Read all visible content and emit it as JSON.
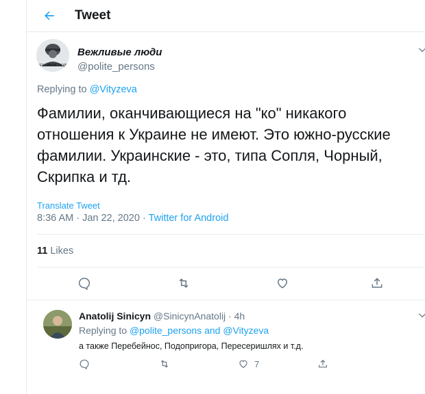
{
  "colors": {
    "accent": "#1da1f2",
    "secondary_text": "#657786",
    "divider": "#e6ecf0"
  },
  "header": {
    "title": "Tweet",
    "back_icon": "arrow-left-icon"
  },
  "main_tweet": {
    "display_name": "Вежливые люди",
    "handle": "@polite_persons",
    "replying_prefix": "Replying to ",
    "replying_handle": "@Vityzeva",
    "text": "Фамилии, оканчивающиеся на \"ко\" никакого отношения к Украине не имеют. Это южно-русские фамилии. Украинские - это, типа Сопля, Чорный, Скрипка и тд.",
    "translate_label": "Translate Tweet",
    "timestamp": "8:36 AM · Jan 22, 2020 · ",
    "source": "Twitter for Android",
    "likes_count": "11",
    "likes_label": " Likes",
    "avatar_text": "ВЕЖЛИВЫЕ ЛЮДИ",
    "actions": [
      "reply-icon",
      "retweet-icon",
      "like-icon",
      "share-icon"
    ]
  },
  "reply_tweet": {
    "display_name": "Anatolij Sinicyn",
    "handle_time": " @SinicynAnatolij · 4h",
    "replying_prefix": "Replying to ",
    "replying_handles": "@polite_persons and @Vityzeva",
    "text": "а также Перебейнос, Подопригора, Пересеришлях и т.д.",
    "like_count": "7"
  }
}
